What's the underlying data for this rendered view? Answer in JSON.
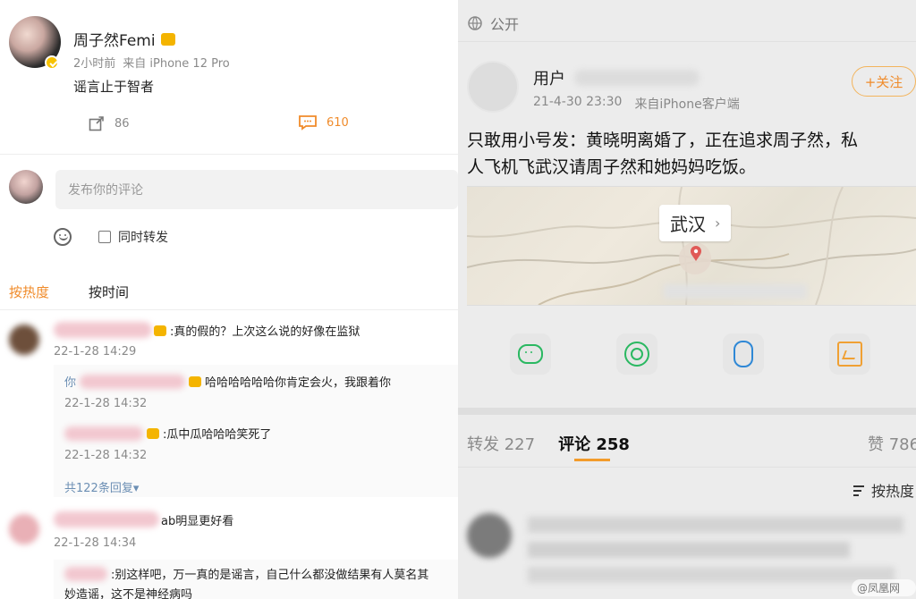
{
  "left": {
    "post": {
      "author": "周子然Femi",
      "time": "2小时前",
      "source": "来自 iPhone 12 Pro",
      "content": "谣言止于智者",
      "repost_count": "86",
      "comment_count": "610"
    },
    "composer": {
      "placeholder": "发布你的评论",
      "repost_option": "同时转发"
    },
    "sort_tabs": [
      {
        "label": "按热度"
      },
      {
        "label": "按时间"
      }
    ],
    "comments": [
      {
        "text": ":真的假的？上次这么说的好像在监狱",
        "time": "22-1-28 14:29",
        "replies": [
          {
            "prefix": "你",
            "text": "哈哈哈哈哈哈你肯定会火，我跟着你",
            "time": "22-1-28 14:32"
          },
          {
            "text": ":瓜中瓜哈哈哈笑死了",
            "time": "22-1-28 14:32"
          }
        ],
        "more_replies": "共122条回复▾"
      },
      {
        "text": "ab明显更好看",
        "time": "22-1-28 14:34",
        "replies": [
          {
            "text": ":别这样吧，万一真的是谣言，自己什么都没做结果有人莫名其",
            "line2": "妙造谣，这不是神经病吗"
          }
        ]
      }
    ]
  },
  "right": {
    "visibility": "公开",
    "post": {
      "user": "用户",
      "time": "21-4-30 23:30",
      "source": "来自iPhone客户端",
      "follow": "+关注",
      "content_line1": "只敢用小号发：黄晓明离婚了，正在追求周子然，私",
      "content_line2": "人飞机飞武汉请周子然和她妈妈吃饭。"
    },
    "map": {
      "label": "武汉"
    },
    "tabs": {
      "repost": "转发 227",
      "comment": "评论 258",
      "like": "赞 786"
    },
    "sort": {
      "label": "按热度"
    },
    "watermark": "@凤凰网"
  },
  "icons": {
    "verified_badge": "verified-icon",
    "repost": "repost-icon",
    "comment": "comment-icon",
    "emoji": "emoji-icon",
    "checkbox": "checkbox-icon",
    "globe": "globe-icon",
    "share_wechat": "wechat-icon",
    "share_moments": "moments-icon",
    "share_qq": "qq-icon",
    "share_save": "save-image-icon",
    "sort": "sort-icon"
  }
}
